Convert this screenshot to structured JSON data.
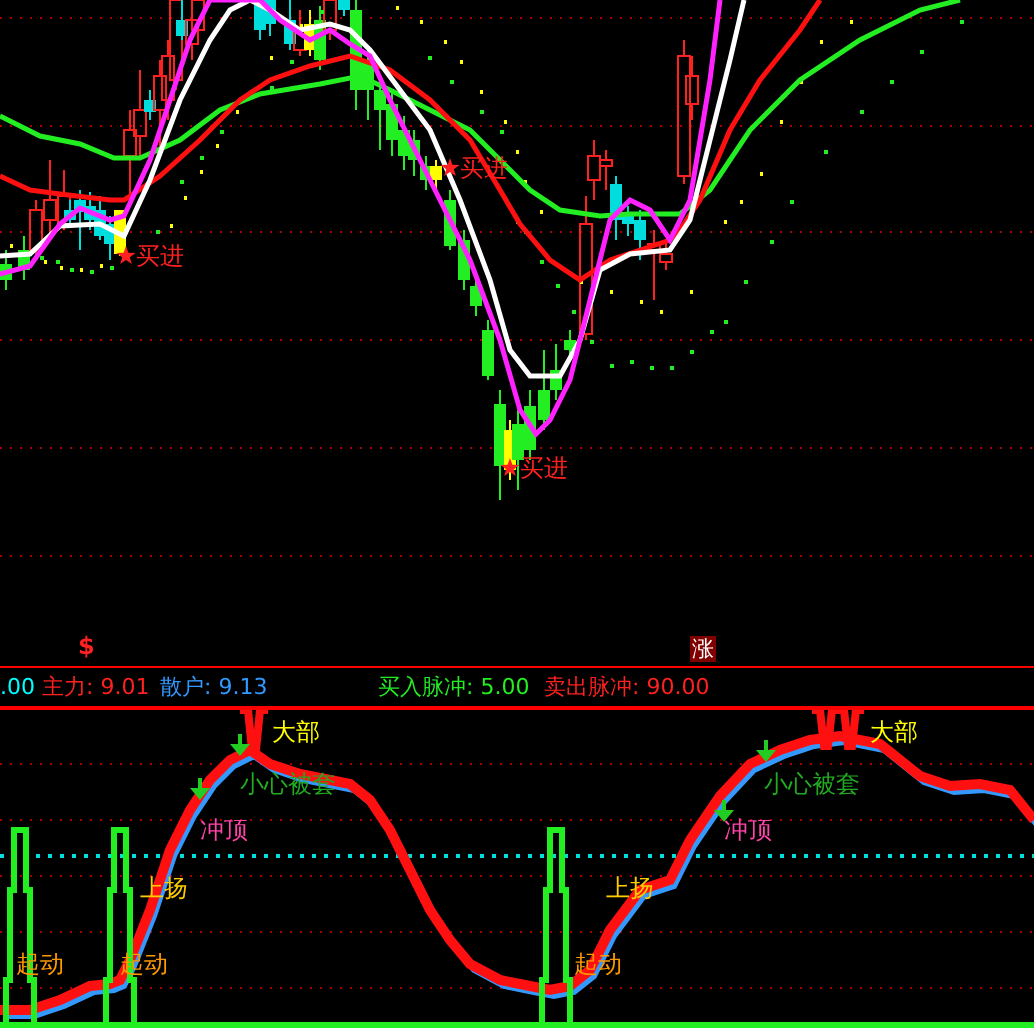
{
  "price_chart": {
    "signals": [
      {
        "label": "买进"
      },
      {
        "label": "买进"
      },
      {
        "label": "买进"
      }
    ],
    "markers": [
      {
        "label": "$",
        "kind": "arrow"
      },
      {
        "label": "涨",
        "kind": "box"
      }
    ]
  },
  "legend": [
    {
      "label": ".00",
      "color": "#00ffff"
    },
    {
      "label": "主力: 9.01",
      "color": "#ff2020"
    },
    {
      "label": "散户: 9.13",
      "color": "#3399ff"
    },
    {
      "label": "买入脉冲: 5.00",
      "color": "#22ee22"
    },
    {
      "label": "卖出脉冲: 90.00",
      "color": "#ff2020"
    }
  ],
  "indicator_chart": {
    "labels": [
      {
        "text": "大部",
        "color": "#ffff00"
      },
      {
        "text": "小心被套",
        "color": "#22aa22"
      },
      {
        "text": "冲顶",
        "color": "#ff44aa"
      },
      {
        "text": "上扬",
        "color": "#ffcc00"
      },
      {
        "text": "起动",
        "color": "#ff9900"
      },
      {
        "text": "起动",
        "color": "#ff9900"
      },
      {
        "text": "大部",
        "color": "#ffff00"
      },
      {
        "text": "小心被套",
        "color": "#22aa22"
      },
      {
        "text": "冲顶",
        "color": "#ff44aa"
      },
      {
        "text": "上扬",
        "color": "#ffcc00"
      },
      {
        "text": "起动",
        "color": "#ff9900"
      }
    ]
  }
}
